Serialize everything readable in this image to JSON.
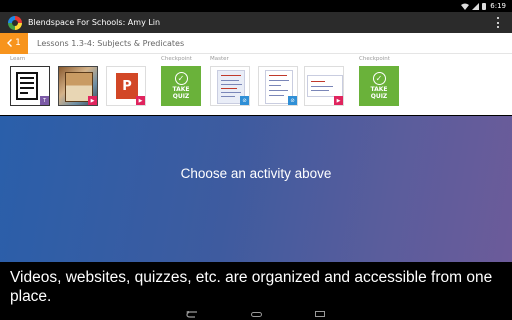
{
  "status_bar": {
    "time": "6:19"
  },
  "app_bar": {
    "title": "Blendspace For Schools: Amy Lin"
  },
  "lesson": {
    "number": "1",
    "title": "Lessons 1.3-4: Subjects & Predicates"
  },
  "sections": {
    "learn": "Learn",
    "checkpoint1": "Checkpoint",
    "master": "Master",
    "checkpoint2": "Checkpoint"
  },
  "quiz": {
    "line1": "TAKE",
    "line2": "QUIZ",
    "check": "✓"
  },
  "ppt_letter": "P",
  "main": {
    "prompt": "Choose an activity above"
  },
  "caption": "Videos, websites, quizzes, etc. are organized and accessible from one place.",
  "colors": {
    "accent_orange": "#f7941d",
    "quiz_green": "#6ab23a",
    "ppt_red": "#d24726",
    "text_badge_purple": "#7b5aa6",
    "video_badge_pink": "#e0245e",
    "link_badge_blue": "#2f8fd6"
  }
}
